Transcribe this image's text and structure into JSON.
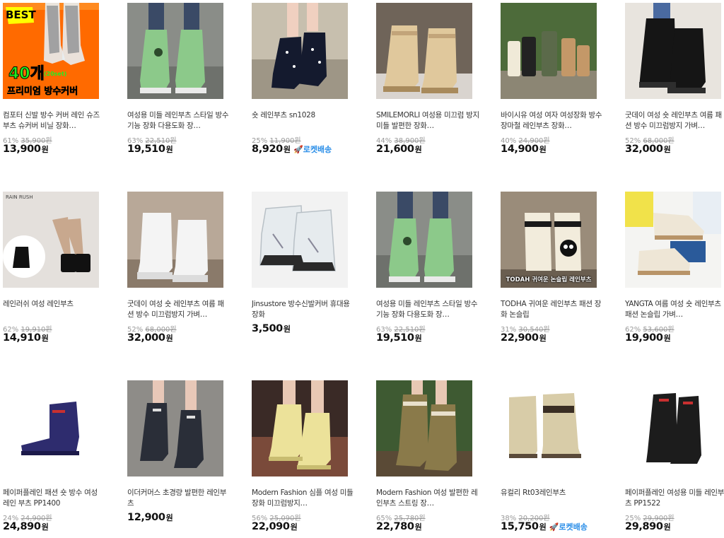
{
  "products": [
    {
      "title": "컴포터 신발 방수 커버 레인 슈즈 부츠 슈커버 비닐 장화…",
      "discount": "61%",
      "original": "35,900원",
      "price": "13,900",
      "won": "원",
      "rocket": "",
      "badge": {
        "best": "BEST",
        "count": "40개",
        "sub": "(20set)",
        "line": "프리미엄 방수커버"
      }
    },
    {
      "title": "여성용 미들 레인부츠 스타일 방수 기능 장화 다용도화 장…",
      "discount": "63%",
      "original": "22,510원",
      "price": "19,510",
      "won": "원",
      "rocket": ""
    },
    {
      "title": "숏 레인부츠 sn1028",
      "discount": "25%",
      "original": "11,900원",
      "price": "8,920",
      "won": "원",
      "rocket": "🚀로켓배송"
    },
    {
      "title": "SMILEMORLI 여성용 미끄럼 방지 미들 발편한 장화…",
      "discount": "44%",
      "original": "38,900원",
      "price": "21,600",
      "won": "원",
      "rocket": ""
    },
    {
      "title": "바이시유 여성 여자 여성장화 방수 장마철 레인부츠 장화…",
      "discount": "40%",
      "original": "24,900원",
      "price": "14,900",
      "won": "원",
      "rocket": ""
    },
    {
      "title": "굿데이 여성 숏 레인부츠 여름 패션 방수 미끄럼방지 가벼…",
      "discount": "52%",
      "original": "68,000원",
      "price": "32,000",
      "won": "원",
      "rocket": ""
    },
    {
      "title": "레인러쉬 여성 레인부츠",
      "discount": "62%",
      "original": "19,910원",
      "price": "14,910",
      "won": "원",
      "rocket": "",
      "brand": "RAIN RUSH"
    },
    {
      "title": "굿데이 여성 숏 레인부츠 여름 패션 방수 미끄럼방지 가벼…",
      "discount": "52%",
      "original": "68,000원",
      "price": "32,000",
      "won": "원",
      "rocket": ""
    },
    {
      "title": "Jinsustore 방수신발커버 휴대용 장화",
      "discount": "",
      "original": "",
      "price": "3,500",
      "won": "원",
      "rocket": ""
    },
    {
      "title": "여성용 미들 레인부츠 스타일 방수 기능 장화 다용도화 장…",
      "discount": "63%",
      "original": "22,510원",
      "price": "19,510",
      "won": "원",
      "rocket": ""
    },
    {
      "title": "TODHA 귀여운 레인부츠 패션 장화 논슬립",
      "discount": "31%",
      "original": "30,540원",
      "price": "22,900",
      "won": "원",
      "rocket": "",
      "caption": "TODAH 귀여운 논슬립 레인부츠"
    },
    {
      "title": "YANGTA 여름 여성 숏 레인부츠 패션 논슬립 가벼…",
      "discount": "62%",
      "original": "53,600원",
      "price": "19,900",
      "won": "원",
      "rocket": ""
    },
    {
      "title": "페이퍼플레인 패션 숏 방수 여성 레인 부츠 PP1400",
      "discount": "24%",
      "original": "24,900원",
      "price": "24,890",
      "won": "원",
      "rocket": ""
    },
    {
      "title": "이더커머스 초경량 발편한 레인부츠",
      "discount": "",
      "original": "",
      "price": "12,900",
      "won": "원",
      "rocket": ""
    },
    {
      "title": "Modern Fashion 심플 여성 미들 장화 미끄럼방지…",
      "discount": "56%",
      "original": "25,090원",
      "price": "22,090",
      "won": "원",
      "rocket": ""
    },
    {
      "title": "Modern Fashion 여성 발편한 레인부츠 스트링 장…",
      "discount": "65%",
      "original": "25,780원",
      "price": "22,780",
      "won": "원",
      "rocket": ""
    },
    {
      "title": "유컬리 Rt03레인부츠",
      "discount": "38%",
      "original": "20,200원",
      "price": "15,750",
      "won": "원",
      "rocket": "🚀로켓배송"
    },
    {
      "title": "페이퍼플레인 여성용 미들 레인부츠 PP1522",
      "discount": "25%",
      "original": "29,900원",
      "price": "29,890",
      "won": "원",
      "rocket": ""
    }
  ],
  "colors": {
    "rocket": "#2a8ee8",
    "best_bg": "#ff6a00",
    "best_text": "#22ee22"
  }
}
